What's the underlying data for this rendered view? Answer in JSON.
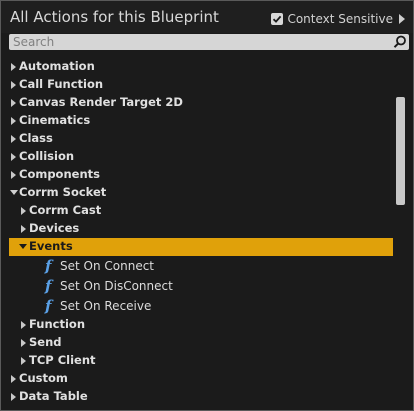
{
  "header": {
    "title": "All Actions for this Blueprint",
    "context_sensitive_label": "Context Sensitive",
    "context_sensitive_checked": true
  },
  "search": {
    "placeholder": "Search"
  },
  "tree": {
    "automation": "Automation",
    "call_function": "Call Function",
    "canvas_render_target": "Canvas Render Target 2D",
    "cinematics": "Cinematics",
    "class": "Class",
    "collision": "Collision",
    "components": "Components",
    "corm_socket": "Corrm Socket",
    "corm_cast": "Corrm Cast",
    "devices": "Devices",
    "events": "Events",
    "set_on_connect": "Set On Connect",
    "set_on_disconnect": "Set On DisConnect",
    "set_on_receive": "Set On Receive",
    "function": "Function",
    "send": "Send",
    "tcp_client": "TCP Client",
    "custom": "Custom",
    "data_table": "Data Table"
  },
  "icons": {
    "function_glyph": "f"
  },
  "colors": {
    "selected_row": "#e0a10a",
    "function_icon": "#5aa0e6",
    "panel_bg": "#1b1b1b"
  }
}
